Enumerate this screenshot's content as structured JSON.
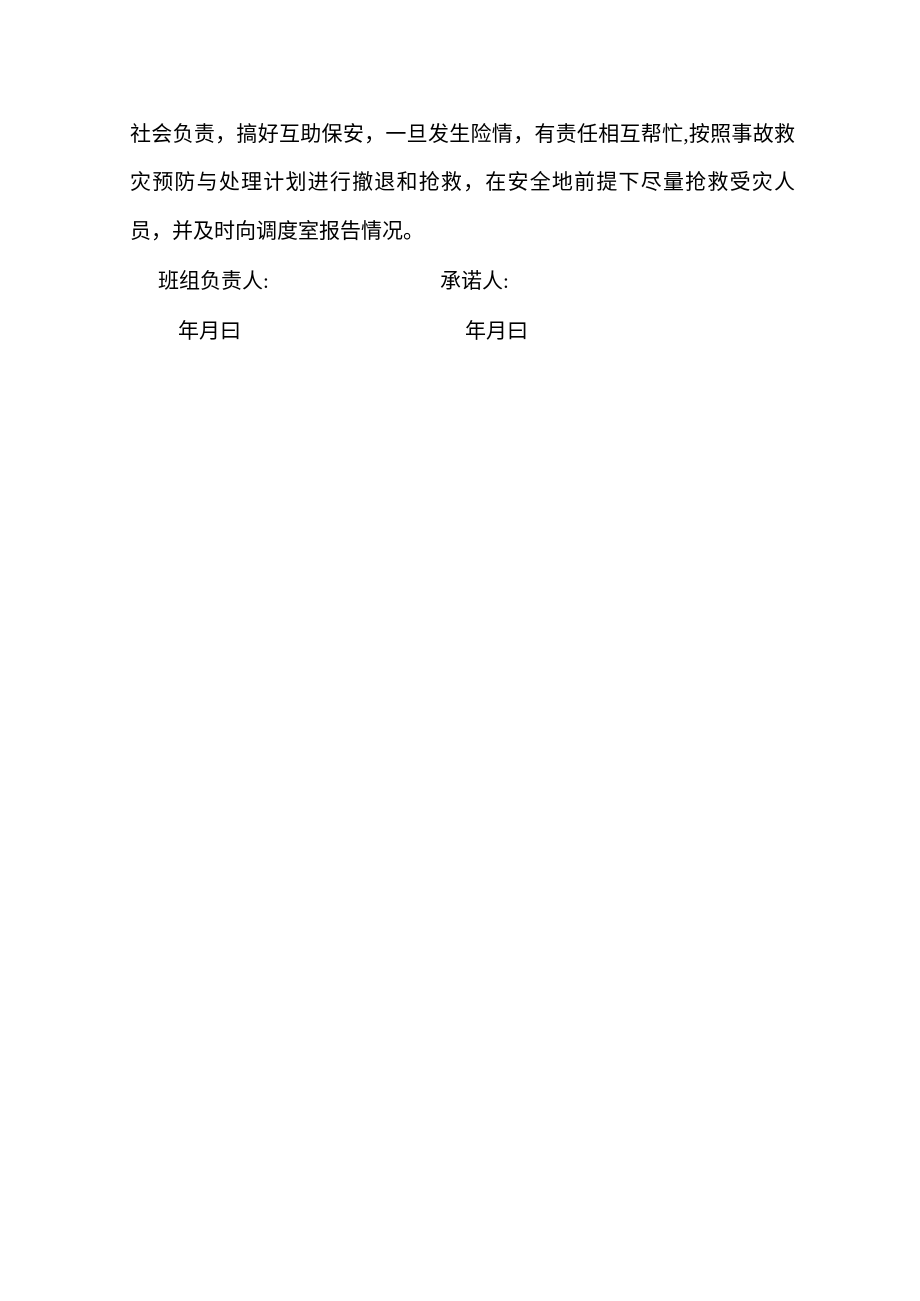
{
  "body": {
    "paragraph": "社会负责，搞好互助保安，一旦发生险情，有责任相互帮忙,按照事故救灾预防与处理计划进行撤退和抢救，在安全地前提下尽量抢救受灾人员，并及时向调度室报告情况。"
  },
  "signatures": {
    "leader_label": "班组负责人:",
    "promiser_label": "承诺人:",
    "date_left": "年月曰",
    "date_right": "年月曰"
  }
}
